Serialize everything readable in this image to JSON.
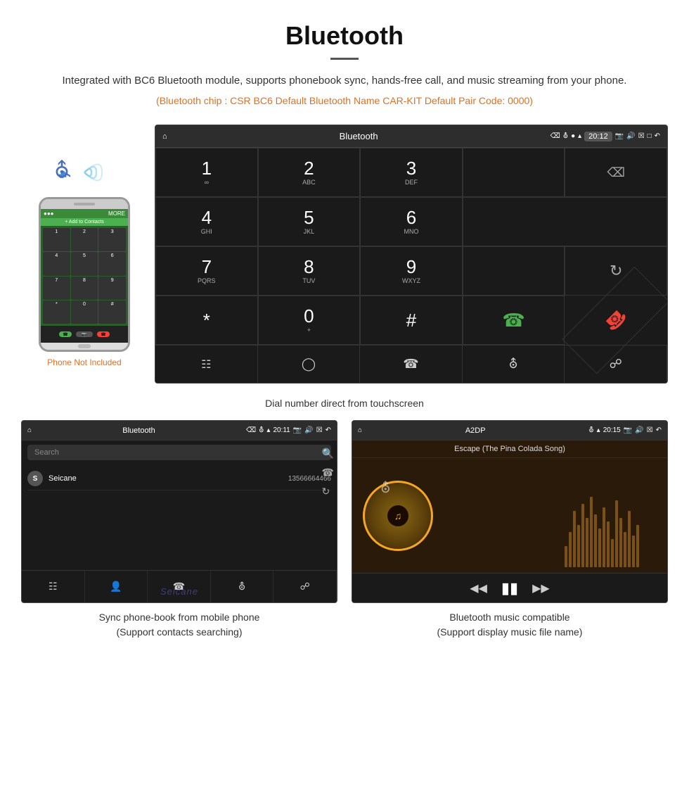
{
  "page": {
    "title": "Bluetooth",
    "description": "Integrated with BC6 Bluetooth module, supports phonebook sync, hands-free call, and music streaming from your phone.",
    "specs": "(Bluetooth chip : CSR BC6   Default Bluetooth Name CAR-KIT    Default Pair Code: 0000)",
    "phone_not_included": "Phone Not Included",
    "dial_caption": "Dial number direct from touchscreen",
    "phonebook_caption_line1": "Sync phone-book from mobile phone",
    "phonebook_caption_line2": "(Support contacts searching)",
    "music_caption_line1": "Bluetooth music compatible",
    "music_caption_line2": "(Support display music file name)"
  },
  "dialpad_screen": {
    "statusbar": {
      "title": "Bluetooth",
      "time": "20:12"
    },
    "keys": [
      {
        "number": "1",
        "letters": "∞"
      },
      {
        "number": "2",
        "letters": "ABC"
      },
      {
        "number": "3",
        "letters": "DEF"
      },
      {
        "number": "",
        "letters": ""
      },
      {
        "number": "⌫",
        "letters": ""
      },
      {
        "number": "4",
        "letters": "GHI"
      },
      {
        "number": "5",
        "letters": "JKL"
      },
      {
        "number": "6",
        "letters": "MNO"
      },
      {
        "number": "",
        "letters": ""
      },
      {
        "number": "",
        "letters": ""
      },
      {
        "number": "7",
        "letters": "PQRS"
      },
      {
        "number": "8",
        "letters": "TUV"
      },
      {
        "number": "9",
        "letters": "WXYZ"
      },
      {
        "number": "",
        "letters": ""
      },
      {
        "number": "↺",
        "letters": ""
      },
      {
        "number": "*",
        "letters": ""
      },
      {
        "number": "0",
        "letters": "+"
      },
      {
        "number": "#",
        "letters": ""
      },
      {
        "number": "📞",
        "letters": ""
      },
      {
        "number": "📞",
        "letters": "end"
      }
    ]
  },
  "phonebook_screen": {
    "statusbar": {
      "title": "Bluetooth",
      "time": "20:11"
    },
    "search_placeholder": "Search",
    "contacts": [
      {
        "initial": "S",
        "name": "Seicane",
        "number": "13566664466"
      }
    ]
  },
  "music_screen": {
    "statusbar": {
      "title": "A2DP",
      "time": "20:15"
    },
    "song_title": "Escape (The Pina Colada Song)"
  }
}
